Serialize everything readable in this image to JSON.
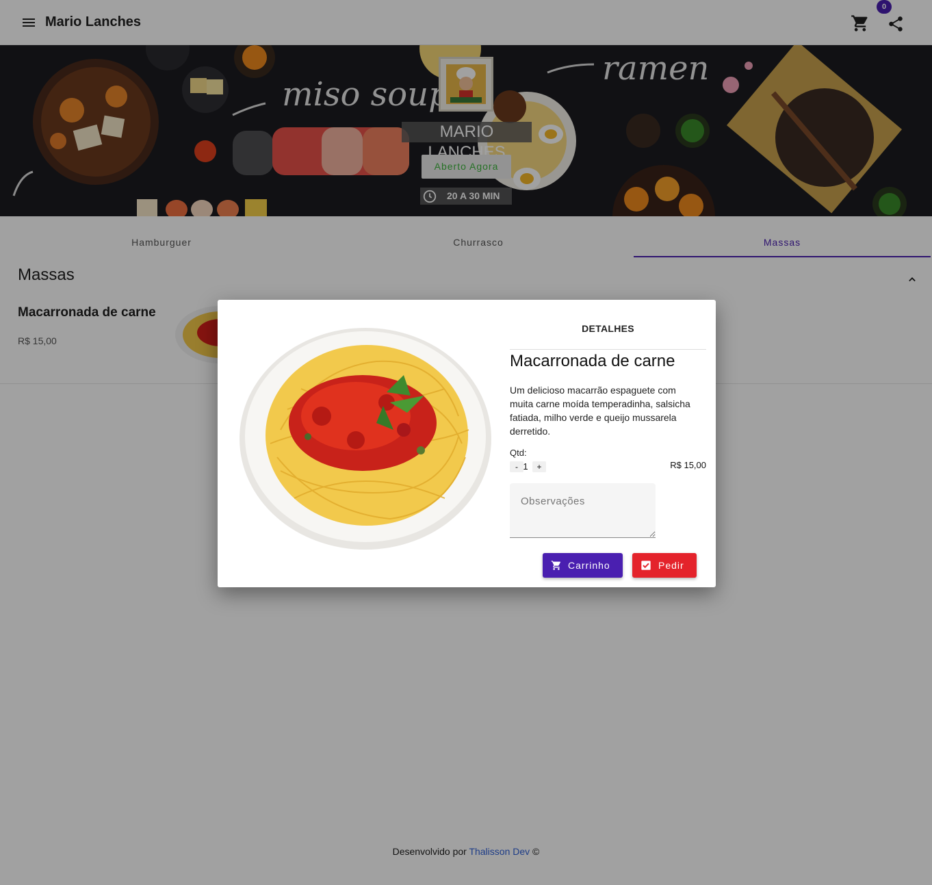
{
  "app": {
    "title": "Mario Lanches",
    "cart_count": "0"
  },
  "icons": {
    "menu": "menu-icon",
    "cart": "cart-icon",
    "share": "share-icon",
    "clock": "clock-icon",
    "chevron": "chevron-up-icon",
    "check": "checkbox-icon"
  },
  "banner": {
    "shop_name": "MARIO LANCHES",
    "status": "Aberto Agora",
    "delivery_time": "20 A 30 MIN",
    "art_text_1": "miso soup",
    "art_text_2": "ramen"
  },
  "tabs": [
    {
      "label": "Hamburguer"
    },
    {
      "label": "Churrasco"
    },
    {
      "label": "Massas",
      "active": true
    }
  ],
  "section": {
    "title": "Massas",
    "items": [
      {
        "name": "Macarronada de carne",
        "price": "R$ 15,00"
      }
    ]
  },
  "dialog": {
    "header": "DETALHES",
    "name": "Macarronada de carne",
    "description": "Um delicioso macarrão espaguete com muita carne moída temperadinha, salsicha fatiada, milho verde e queijo mussarela derretido.",
    "qty_label": "Qtd:",
    "minus": "-",
    "quantity": "1",
    "plus": "+",
    "price": "R$ 15,00",
    "notes_placeholder": "Observações",
    "cart_button": "Carrinho",
    "order_button": "Pedir"
  },
  "footer": {
    "prefix": "Desenvolvido por",
    "author": "Thalisson Dev",
    "suffix": "©"
  },
  "colors": {
    "primary": "#4a1fb0",
    "danger": "#e4232b",
    "open": "#3cb43c",
    "link": "#2f5fd6"
  }
}
